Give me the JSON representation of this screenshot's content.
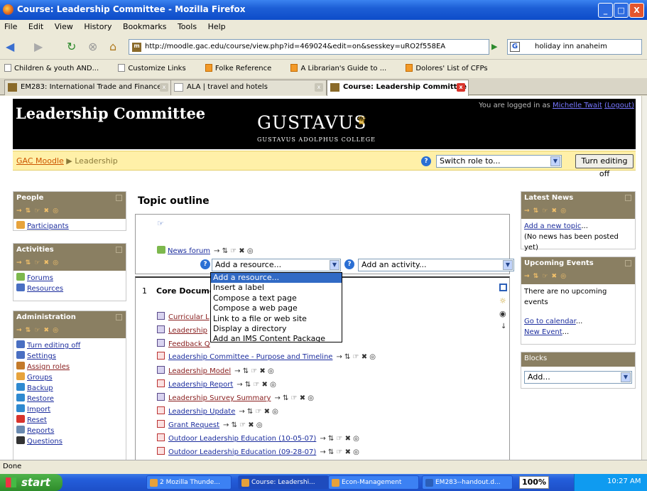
{
  "window": {
    "title": "Course: Leadership Committee - Mozilla Firefox",
    "min": "_",
    "max": "□",
    "close": "X"
  },
  "menu": [
    "File",
    "Edit",
    "View",
    "History",
    "Bookmarks",
    "Tools",
    "Help"
  ],
  "nav": {
    "url": "http://moodle.gac.edu/course/view.php?id=469024&edit=on&sesskey=uRO2f558EA",
    "search": "holiday inn anaheim"
  },
  "bookmarks": [
    "Children & youth AND...",
    "Customize Links",
    "Folke Reference",
    "A Librarian's Guide to ...",
    "Dolores' List of CFPs"
  ],
  "tabs": [
    "EM283: International Trade and Finance",
    "ALA | travel and hotels",
    "Course: Leadership Committee"
  ],
  "page": {
    "title": "Leadership Committee",
    "logo_main": "GUSTAVUS",
    "logo_sub": "GUSTAVUS ADOLPHUS COLLEGE",
    "login_prefix": "You are logged in as ",
    "login_user": "Michelle Twait",
    "login_logout": "(Logout)",
    "crumb_home": "GAC Moodle",
    "crumb_sep": " ▶ ",
    "crumb_current": "Leadership",
    "switch_role": "Switch role to...",
    "turn_edit_off": "Turn editing off"
  },
  "left": {
    "people": {
      "title": "People",
      "items": [
        "Participants"
      ]
    },
    "activities": {
      "title": "Activities",
      "items": [
        "Forums",
        "Resources"
      ]
    },
    "admin": {
      "title": "Administration",
      "items": [
        "Turn editing off",
        "Settings",
        "Assign roles",
        "Groups",
        "Backup",
        "Restore",
        "Import",
        "Reset",
        "Reports",
        "Questions"
      ]
    }
  },
  "main": {
    "topic_title": "Topic outline",
    "news_forum": "News forum",
    "add_resource": "Add a resource...",
    "add_activity": "Add an activity...",
    "dropdown": [
      "Add a resource...",
      "Insert a label",
      "Compose a text page",
      "Compose a web page",
      "Link to a file or web site",
      "Display a directory",
      "Add an IMS Content Package"
    ],
    "section_num": "1",
    "section_title": "Core Document",
    "resources": [
      "Curricular L",
      "Leadership ",
      "Feedback Q",
      "Leadership Committee - Purpose and Timeline",
      "Leadership Model",
      "Leadership Report",
      "Leadership Survey Summary",
      "Leadership Update",
      "Grant Request",
      "Outdoor Leadership Education (10-05-07)",
      "Outdoor Leadership Education (09-28-07)"
    ]
  },
  "right": {
    "news": {
      "title": "Latest News",
      "add": "Add a new topic",
      "add_suffix": "...",
      "empty": "(No news has been posted yet)"
    },
    "events": {
      "title": "Upcoming Events",
      "empty": "There are no upcoming events",
      "goto": "Go to calendar",
      "goto_suffix": "...",
      "new": "New Event",
      "new_suffix": "..."
    },
    "blocks": {
      "title": "Blocks",
      "select": "Add..."
    }
  },
  "status": "Done",
  "taskbar": {
    "start": "start",
    "items": [
      "2 Mozilla Thunde...",
      "Course: Leadershi...",
      "Econ-Management",
      "EM283--handout.d..."
    ],
    "zoom": "100%",
    "clock": "10:27 AM"
  },
  "edit_icons": "→ ⇅ ☞ ✖ ◎",
  "colors": {
    "header": "#000000",
    "navrow": "#fff0a8",
    "block_head": "#8a7f62",
    "link": "#1d2e9e"
  }
}
